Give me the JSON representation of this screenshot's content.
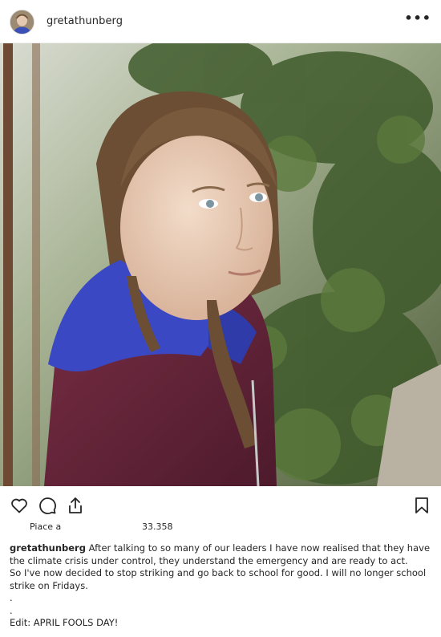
{
  "header": {
    "username": "gretathunberg",
    "more_glyph": "•••",
    "avatar_icon": "profile-avatar"
  },
  "photo": {
    "description_icon": "post-photo"
  },
  "actions": {
    "like_icon": "heart-icon",
    "comment_icon": "comment-icon",
    "share_icon": "share-icon",
    "save_icon": "bookmark-icon"
  },
  "likes": {
    "label": "Piace a",
    "count": "33.358"
  },
  "caption": {
    "username": "gretathunberg",
    "line1": "After talking to so many of our leaders I have now realised that they have the climate crisis under control, they understand the emergency and are ready to act.",
    "line2": "So I've now decided to stop striking and go back to school for good. I will no longer school strike on Fridays.",
    "dot1": ".",
    "dot2": ".",
    "edit": "Edit: APRIL FOOLS DAY!"
  }
}
